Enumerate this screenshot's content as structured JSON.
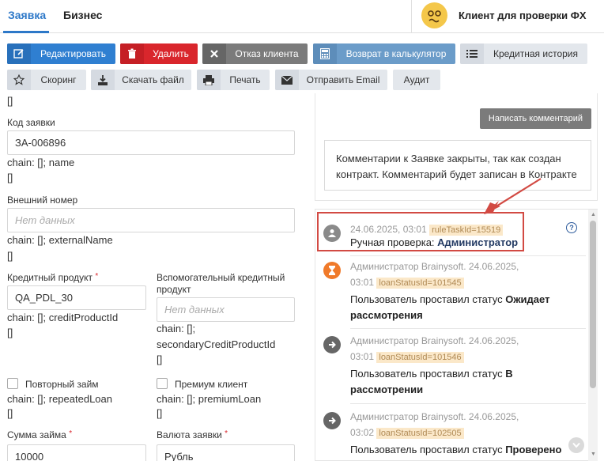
{
  "tabs": [
    {
      "label": "Заявка"
    },
    {
      "label": "Бизнес"
    }
  ],
  "client": {
    "name": "Клиент для проверки ФХ"
  },
  "toolbar": {
    "edit": "Редактировать",
    "delete": "Удалить",
    "refuse": "Отказ клиента",
    "calc": "Возврат в калькулятор",
    "credit_history": "Кредитная история",
    "scoring": "Скоринг",
    "download": "Скачать файл",
    "print": "Печать",
    "email": "Отправить Email",
    "audit": "Аудит"
  },
  "form": {
    "top_bracket": "[]",
    "code": {
      "label": "Код заявки",
      "value": "ЗА-006896",
      "chain": "chain: []; name",
      "bracket": "[]"
    },
    "external": {
      "label": "Внешний номер",
      "placeholder": "Нет данных",
      "chain": "chain: []; externalName",
      "bracket": "[]"
    },
    "credit_product": {
      "label": "Кредитный продукт",
      "req": "*",
      "value": "QA_PDL_30",
      "chain": "chain: []; creditProductId",
      "bracket": "[]"
    },
    "secondary": {
      "label1": "Вспомогательный кредитный",
      "label2": "продукт",
      "placeholder": "Нет данных",
      "chain1": "chain: [];",
      "chain2": "secondaryCreditProductId",
      "bracket": "[]"
    },
    "repeated": {
      "label": "Повторный займ",
      "chain": "chain: []; repeatedLoan",
      "bracket": "[]"
    },
    "premium": {
      "label": "Премиум клиент",
      "chain": "chain: []; premiumLoan",
      "bracket": "[]"
    },
    "amount": {
      "label": "Сумма займа",
      "req": "*",
      "value": "10000"
    },
    "currency": {
      "label": "Валюта заявки",
      "req": "*",
      "value": "Рубль"
    }
  },
  "comments": {
    "button": "Написать комментарий",
    "closed_text": "Комментарии к Заявке закрыты, так как создан контракт. Комментарий будет записан в Контракте"
  },
  "history": [
    {
      "meta": "24.06.2025, 03:01",
      "tag": "ruleTaskId=15519",
      "body_prefix": "Ручная проверка: ",
      "body_bold": "Администратор",
      "icon": "user-icon",
      "color": "#8a8a8a"
    },
    {
      "meta1": "Администратор Brainysoft. 24.06.2025,",
      "meta2": "03:01",
      "tag": "loanStatusId=101545",
      "body_prefix": "Пользователь проставил статус ",
      "body_bold1": "Ожидает",
      "body_bold2": "рассмотрения",
      "icon": "hourglass-icon",
      "color": "#f07a2a"
    },
    {
      "meta1": "Администратор Brainysoft. 24.06.2025,",
      "meta2": "03:01",
      "tag": "loanStatusId=101546",
      "body_prefix": "Пользователь проставил статус ",
      "body_bold1": "В",
      "body_bold2": "рассмотрении",
      "icon": "arrow-right-icon",
      "color": "#666666"
    },
    {
      "meta1": "Администратор Brainysoft. 24.06.2025,",
      "meta2": "03:02",
      "tag": "loanStatusId=102505",
      "body_prefix": "Пользователь проставил статус ",
      "body_bold1": "Проверено",
      "icon": "arrow-right-icon",
      "color": "#666666"
    }
  ],
  "help": {
    "glyph": "?"
  },
  "colors": {
    "accent": "#2d78c8",
    "danger": "#d9262c",
    "highlight": "#d24a43"
  }
}
